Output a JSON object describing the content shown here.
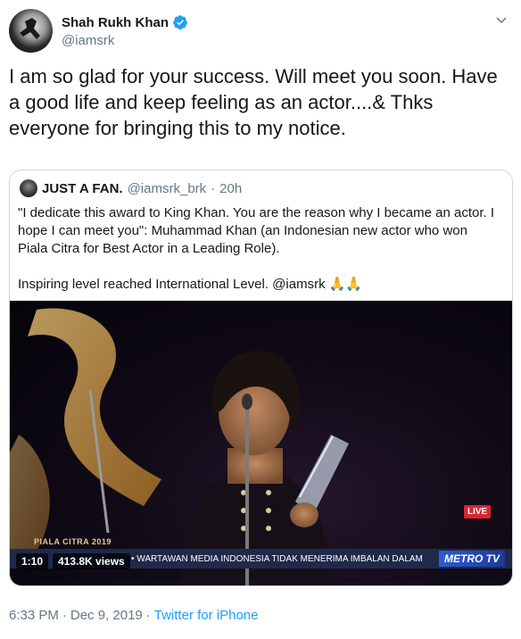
{
  "author": {
    "display_name": "Shah Rukh Khan",
    "handle": "@iamsrk",
    "verified": true
  },
  "tweet": {
    "text": "I am so glad for your success. Will meet you soon. Have a good life and keep feeling as an actor....& Thks everyone for bringing this to my notice."
  },
  "quoted": {
    "display_name": "JUST A FAN.",
    "handle": "@iamsrk_brk",
    "separator": "·",
    "time": "20h",
    "para1": "\"I dedicate this award to King Khan. You are the reason why I became an actor. I hope I can meet you\": Muhammad Khan (an Indonesian new actor who won Piala Citra for Best Actor in a Leading Role).",
    "para2_text": "Inspiring level reached International Level. @iamsrk ",
    "para2_emoji": "🙏🙏",
    "video": {
      "duration": "1:10",
      "views": "413.8K views",
      "live_label": "LIVE",
      "event_logo_text": "PIALA CITRA 2019",
      "ticker": "• WARTAWAN MEDIA INDONESIA TIDAK MENERIMA IMBALAN DALAM",
      "channel_logo": "METRO TV"
    }
  },
  "meta": {
    "time": "6:33 PM",
    "separator1": "·",
    "date": "Dec 9, 2019",
    "separator2": "·",
    "source": "Twitter for iPhone"
  },
  "colors": {
    "link": "#1da1f2",
    "verified": "#1da1f2",
    "secondary_text": "#657786",
    "border": "#ccd6dd"
  }
}
